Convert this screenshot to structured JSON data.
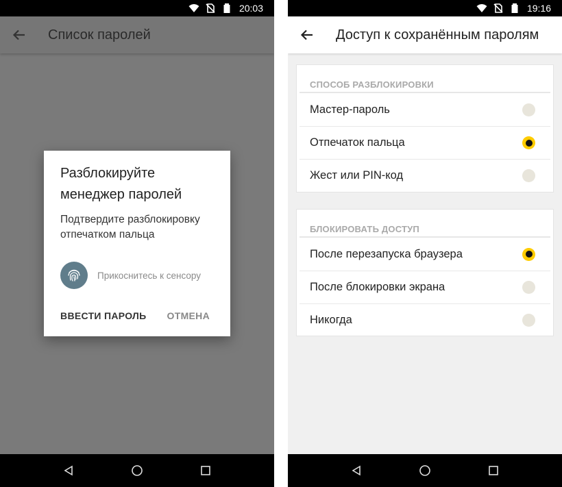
{
  "left": {
    "status_time": "20:03",
    "title": "Список паролей",
    "dialog": {
      "title": "Разблокируйте менеджер паролей",
      "message": "Подтвердите разблокировку отпечатком пальца",
      "hint": "Прикоснитесь к сенсору",
      "enter_password": "ВВЕСТИ ПАРОЛЬ",
      "cancel": "ОТМЕНА"
    }
  },
  "right": {
    "status_time": "19:16",
    "title": "Доступ к сохранённым паролям",
    "unlock_section": {
      "header": "СПОСОБ РАЗБЛОКИРОВКИ",
      "options": [
        {
          "label": "Мастер-пароль",
          "selected": false
        },
        {
          "label": "Отпечаток пальца",
          "selected": true
        },
        {
          "label": "Жест или PIN-код",
          "selected": false
        }
      ]
    },
    "lock_section": {
      "header": "БЛОКИРОВАТЬ ДОСТУП",
      "options": [
        {
          "label": "После перезапуска браузера",
          "selected": true
        },
        {
          "label": "После блокировки экрана",
          "selected": false
        },
        {
          "label": "Никогда",
          "selected": false
        }
      ]
    }
  },
  "icons": {
    "back": "arrow-back-icon",
    "fingerprint": "fingerprint-icon",
    "nav": [
      "back-triangle-icon",
      "home-circle-icon",
      "recents-square-icon"
    ]
  },
  "colors": {
    "accent": "#ffcc00",
    "fingerprint_bg": "#607d8b",
    "scrim": "#7a7a7a"
  }
}
